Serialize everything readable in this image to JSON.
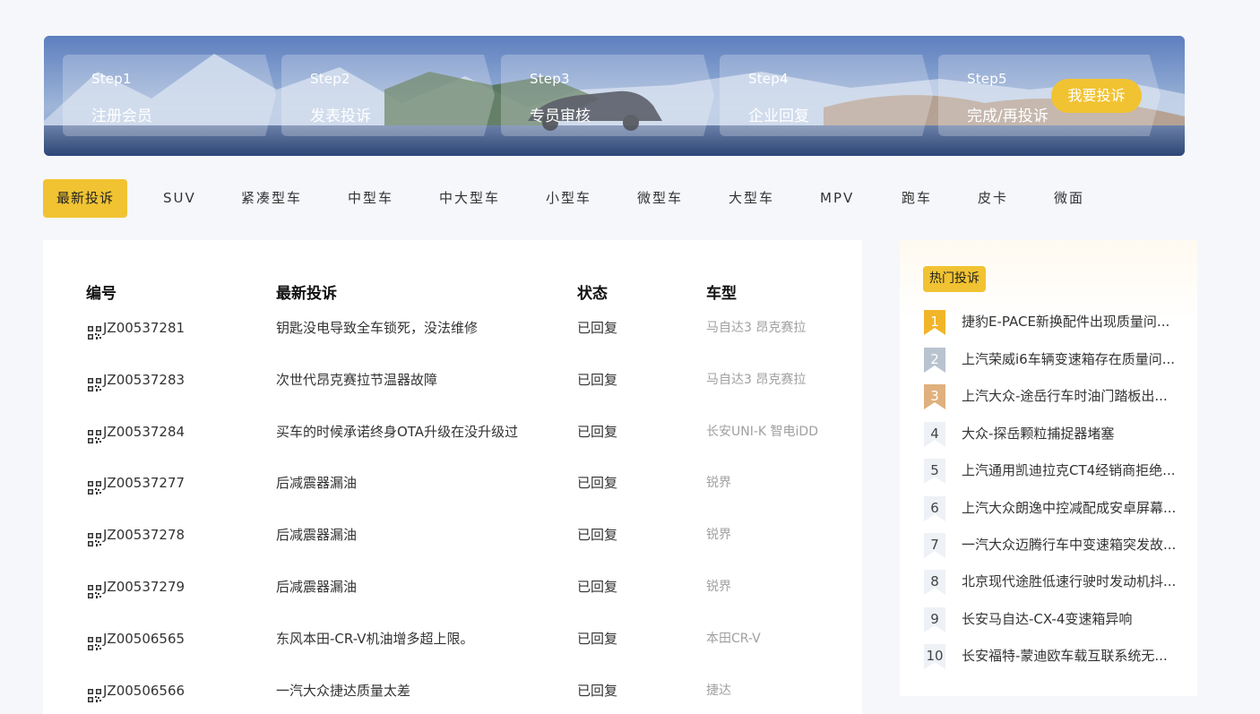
{
  "steps": [
    {
      "num": "Step1",
      "label": "注册会员"
    },
    {
      "num": "Step2",
      "label": "发表投诉"
    },
    {
      "num": "Step3",
      "label": "专员审核"
    },
    {
      "num": "Step4",
      "label": "企业回复"
    },
    {
      "num": "Step5",
      "label": "完成/再投诉"
    }
  ],
  "cta_label": "我要投诉",
  "tabs": [
    "最新投诉",
    "SUV",
    "紧凑型车",
    "中型车",
    "中大型车",
    "小型车",
    "微型车",
    "大型车",
    "MPV",
    "跑车",
    "皮卡",
    "微面"
  ],
  "table": {
    "headers": {
      "id": "编号",
      "title": "最新投诉",
      "status": "状态",
      "model": "车型"
    },
    "rows": [
      {
        "id": "JZ00537281",
        "title": "钥匙没电导致全车锁死，没法维修",
        "status": "已回复",
        "model": "马自达3 昂克赛拉"
      },
      {
        "id": "JZ00537283",
        "title": "次世代昂克赛拉节温器故障",
        "status": "已回复",
        "model": "马自达3 昂克赛拉"
      },
      {
        "id": "JZ00537284",
        "title": "买车的时候承诺终身OTA升级在没升级过",
        "status": "已回复",
        "model": "长安UNI-K 智电iDD"
      },
      {
        "id": "JZ00537277",
        "title": "后减震器漏油",
        "status": "已回复",
        "model": "锐界"
      },
      {
        "id": "JZ00537278",
        "title": "后减震器漏油",
        "status": "已回复",
        "model": "锐界"
      },
      {
        "id": "JZ00537279",
        "title": "后减震器漏油",
        "status": "已回复",
        "model": "锐界"
      },
      {
        "id": "JZ00506565",
        "title": "东风本田-CR-V机油增多超上限。",
        "status": "已回复",
        "model": "本田CR-V"
      },
      {
        "id": "JZ00506566",
        "title": "一汽大众捷达质量太差",
        "status": "已回复",
        "model": "捷达"
      }
    ]
  },
  "hot": {
    "title": "热门投诉",
    "items": [
      {
        "rank": "1",
        "text": "捷豹E-PACE新换配件出现质量问..."
      },
      {
        "rank": "2",
        "text": "上汽荣威i6车辆变速箱存在质量问..."
      },
      {
        "rank": "3",
        "text": "上汽大众-途岳行车时油门踏板出..."
      },
      {
        "rank": "4",
        "text": "大众-探岳颗粒捕捉器堵塞"
      },
      {
        "rank": "5",
        "text": "上汽通用凯迪拉克CT4经销商拒绝..."
      },
      {
        "rank": "6",
        "text": "上汽大众朗逸中控减配成安卓屏幕..."
      },
      {
        "rank": "7",
        "text": "一汽大众迈腾行车中变速箱突发故..."
      },
      {
        "rank": "8",
        "text": "北京现代途胜低速行驶时发动机抖..."
      },
      {
        "rank": "9",
        "text": "长安马自达-CX-4变速箱异响"
      },
      {
        "rank": "10",
        "text": "长安福特-蒙迪欧车载互联系统无..."
      }
    ],
    "rank_colors": [
      "#f1b52a",
      "#b9c2cf",
      "#e0b07e"
    ]
  }
}
